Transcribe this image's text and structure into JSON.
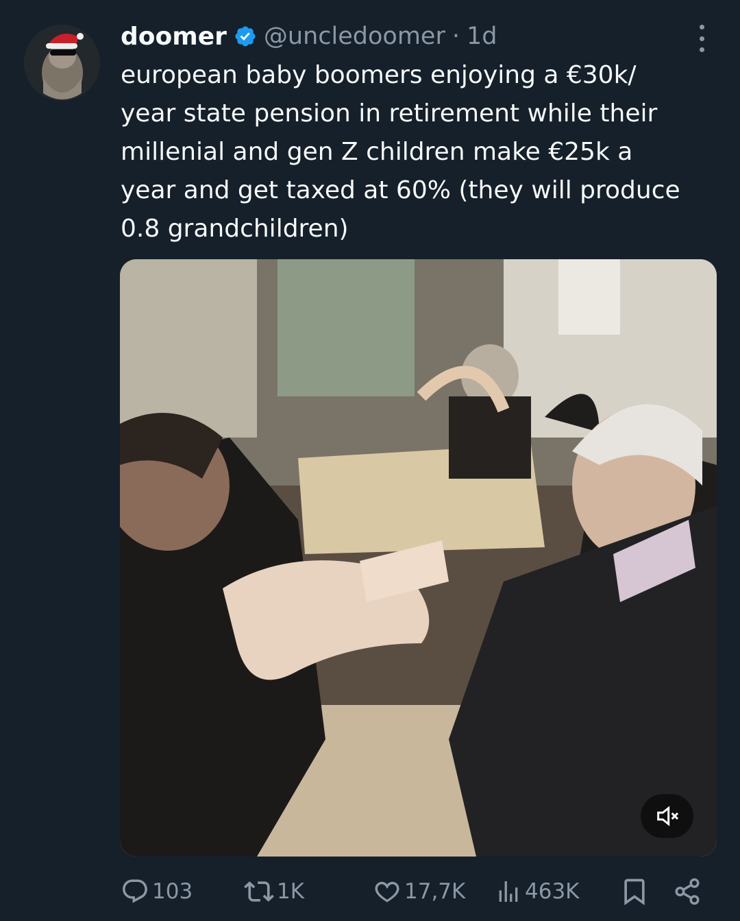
{
  "tweet": {
    "author_name": "doomer",
    "handle": "@uncledoomer",
    "separator": "·",
    "time": "1d",
    "text_lines": [
      "european baby boomers enjoying a €30k/",
      "year state pension in retirement while their",
      "millenial and gen Z children make €25k a",
      "year and get taxed at 60% (they will produce",
      "0.8 grandchildren)"
    ],
    "media": {
      "type": "video",
      "muted": true
    }
  },
  "actions": {
    "replies": "103",
    "reposts": "1K",
    "likes": "17,7K",
    "views": "463K"
  },
  "colors": {
    "background": "#15202b",
    "text": "#f7f9f9",
    "secondary": "#8b98a5",
    "verified": "#1d9bf0"
  },
  "icons": [
    "more-icon",
    "verified-badge-icon",
    "reply-icon",
    "repost-icon",
    "like-icon",
    "views-icon",
    "bookmark-icon",
    "share-icon",
    "volume-muted-icon"
  ]
}
